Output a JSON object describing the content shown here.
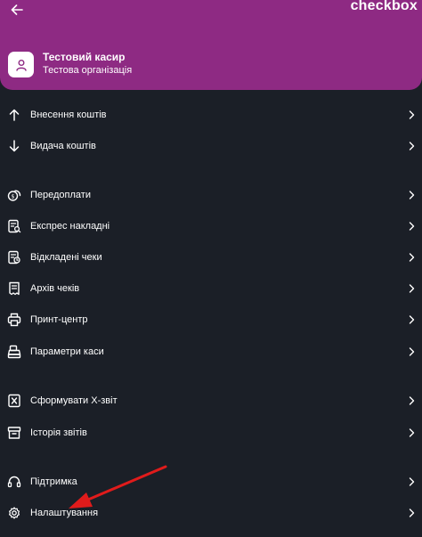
{
  "header": {
    "brand": "checkbox",
    "cashier_name": "Тестовий касир",
    "organization": "Тестова організація",
    "background_color": "#8e2a83"
  },
  "menu": {
    "groups": [
      {
        "items": [
          {
            "label": "Внесення коштів",
            "icon": "arrow-up-icon"
          },
          {
            "label": "Видача коштів",
            "icon": "arrow-down-icon"
          }
        ]
      },
      {
        "items": [
          {
            "label": "Передоплати",
            "icon": "prepayment-coins-icon"
          },
          {
            "label": "Експрес накладні",
            "icon": "express-invoice-icon"
          },
          {
            "label": "Відкладені чеки",
            "icon": "deferred-receipt-icon"
          },
          {
            "label": "Архів чеків",
            "icon": "receipt-archive-icon"
          },
          {
            "label": "Принт-центр",
            "icon": "printer-icon"
          },
          {
            "label": "Параметри каси",
            "icon": "cash-register-icon"
          }
        ]
      },
      {
        "items": [
          {
            "label": "Сформувати X-звіт",
            "icon": "x-report-icon"
          },
          {
            "label": "Історія звітів",
            "icon": "reports-history-icon"
          }
        ]
      },
      {
        "items": [
          {
            "label": "Підтримка",
            "icon": "headset-icon"
          },
          {
            "label": "Налаштування",
            "icon": "gear-icon"
          }
        ]
      }
    ]
  },
  "annotation": {
    "arrow_color": "#e01b1b"
  }
}
